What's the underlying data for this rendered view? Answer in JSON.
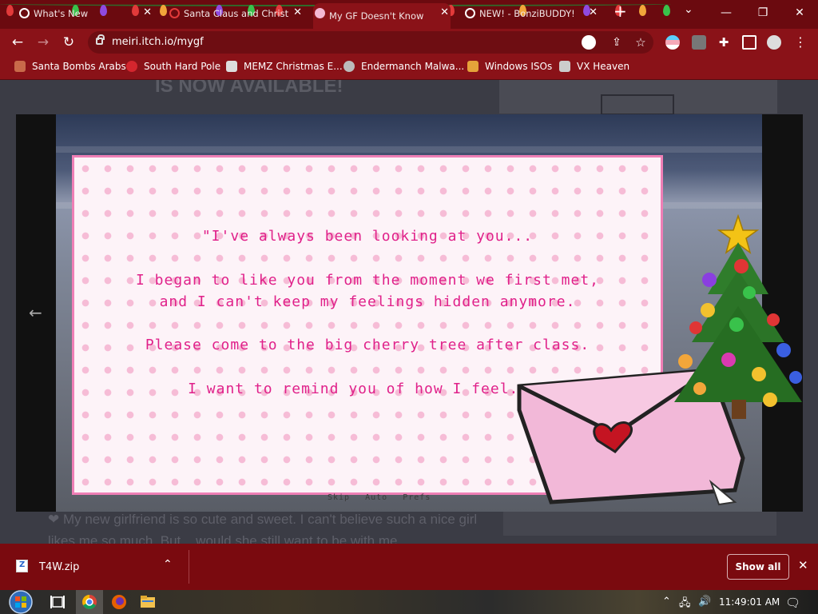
{
  "tabs": [
    {
      "label": "What's New"
    },
    {
      "label": "Santa Claus and Christ"
    },
    {
      "label": "My GF Doesn't Know"
    },
    {
      "label": "NEW! - BonziBUDDY!"
    }
  ],
  "address": {
    "url": "meiri.itch.io/mygf"
  },
  "bookmarks": [
    {
      "label": "Santa Bombs Arabs"
    },
    {
      "label": "South Hard Pole"
    },
    {
      "label": "MEMZ Christmas E..."
    },
    {
      "label": "Endermanch Malwa..."
    },
    {
      "label": "Windows ISOs"
    },
    {
      "label": "VX Heaven"
    }
  ],
  "page": {
    "heading": "IS NOW AVAILABLE!",
    "description": "❤ My new girlfriend is so cute and sweet. I can't believe such a nice girl likes me so much. But... would she still want to be with me"
  },
  "letter": {
    "lines": [
      "\"I've always been looking at you...",
      "I began to like you from the moment we first met,",
      "and I can't keep my feelings hidden anymore.",
      "Please come to the big cherry tree after class.",
      "I want to remind you of how I feel...\""
    ],
    "controls": [
      "Skip",
      "Auto",
      "Prefs"
    ]
  },
  "downloads": {
    "file_name": "T4W.zip",
    "show_all_label": "Show all"
  },
  "taskbar": {
    "clock": "11:49:01 AM"
  },
  "colors": {
    "chrome_dark": "#6b0a0f",
    "chrome": "#8a1218",
    "letter_text": "#e0218a",
    "letter_border": "#ef7fb6",
    "dots": "#f6bcd6"
  }
}
